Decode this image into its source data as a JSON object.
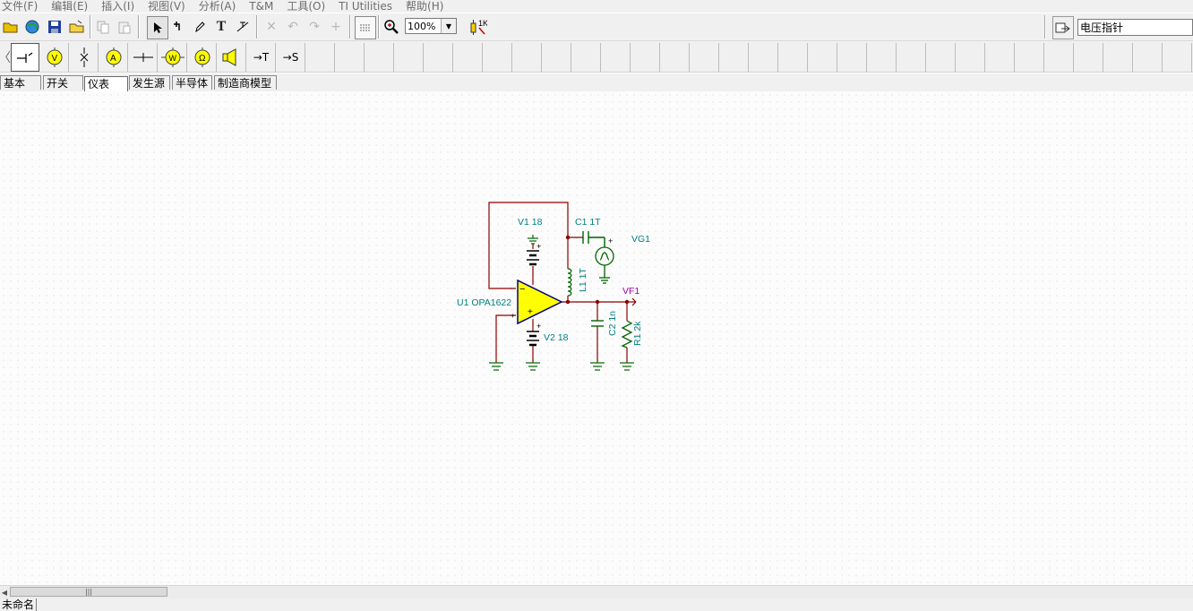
{
  "menu": [
    "文件(F)",
    "编辑(E)",
    "插入(I)",
    "视图(V)",
    "分析(A)",
    "T&M",
    "工具(O)",
    "TI Utilities",
    "帮助(H)"
  ],
  "toolbar": {
    "zoom_value": "100%",
    "pointer_select_value": "电压指针"
  },
  "component_bar": {
    "terminal_t_label": "→T",
    "terminal_s_label": "→S"
  },
  "tabs": [
    "基本",
    "开关",
    "仪表",
    "发生源",
    "半导体",
    "制造商模型"
  ],
  "active_tab": "仪表",
  "schematic": {
    "labels": {
      "v1": "V1 18",
      "c1": "C1 1T",
      "vg1": "VG1",
      "l1": "L1 1T",
      "vf1": "VF1",
      "u1": "U1 OPA1622",
      "c2": "C2 1n",
      "r1": "R1 2k",
      "v2": "V2 18"
    },
    "colors": {
      "wire": "#8b0000",
      "label": "#008080",
      "vf_label": "#a000a0",
      "opamp_fill": "#ffff00",
      "opamp_stroke": "#000080",
      "component": "#006400",
      "battery": "#000000"
    }
  },
  "status": {
    "document_name": "未命名"
  }
}
